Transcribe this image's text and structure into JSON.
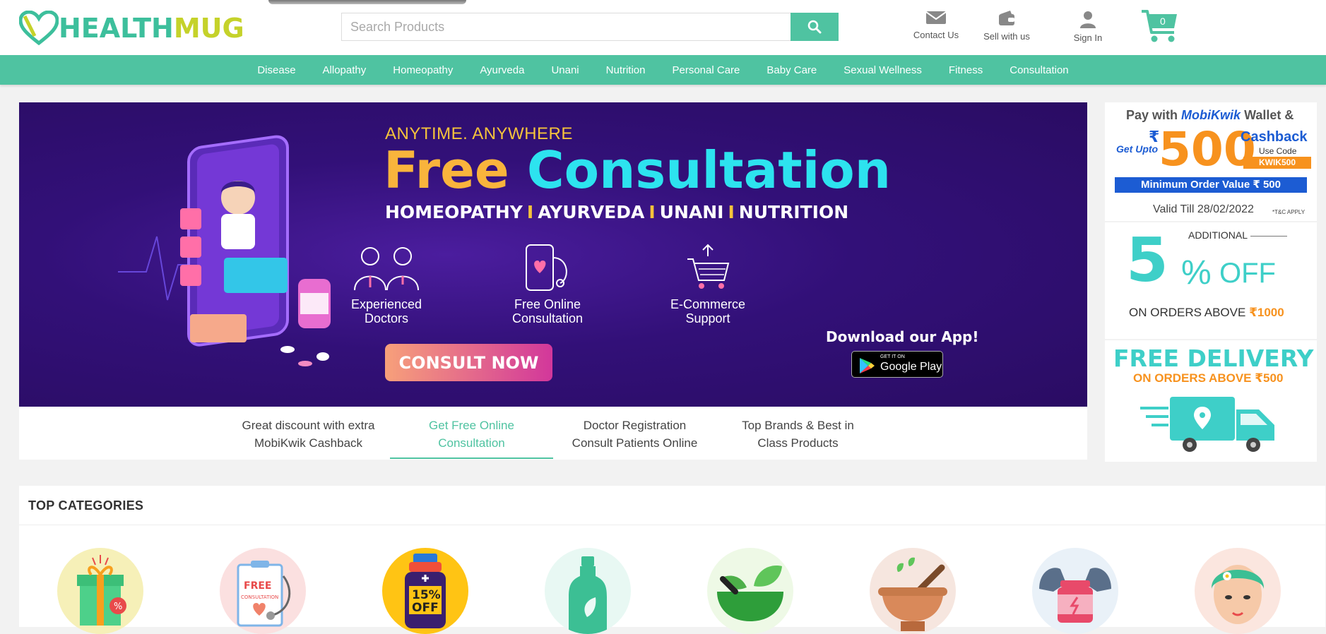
{
  "logo": {
    "part1": "HEALTH",
    "part2": "MUG"
  },
  "search": {
    "placeholder": "Search Products"
  },
  "header_links": {
    "contact": "Contact Us",
    "sell": "Sell with us",
    "signin": "Sign In"
  },
  "cart": {
    "count": "0"
  },
  "nav": [
    "Disease",
    "Allopathy",
    "Homeopathy",
    "Ayurveda",
    "Unani",
    "Nutrition",
    "Personal Care",
    "Baby Care",
    "Sexual Wellness",
    "Fitness",
    "Consultation"
  ],
  "banner": {
    "anytime": "ANYTIME. ANYWHERE",
    "title_free": "Free",
    "title_consult": "Consultation",
    "sub": [
      "HOMEOPATHY",
      "AYURVEDA",
      "UNANI",
      "NUTRITION"
    ],
    "sub_sep": "I",
    "features": [
      {
        "l1": "Experienced",
        "l2": "Doctors"
      },
      {
        "l1": "Free Online",
        "l2": "Consultation"
      },
      {
        "l1": "E-Commerce",
        "l2": "Support"
      }
    ],
    "cta": "CONSULT NOW",
    "download": "Download our App!",
    "gplay_small": "GET IT ON",
    "gplay_big": "Google Play"
  },
  "tabs": [
    {
      "l1": "Great discount with extra",
      "l2": "MobiKwik Cashback"
    },
    {
      "l1": "Get Free Online",
      "l2": "Consultation"
    },
    {
      "l1": "Doctor Registration",
      "l2": "Consult Patients Online"
    },
    {
      "l1": "Top Brands & Best in",
      "l2": "Class Products"
    }
  ],
  "promo1": {
    "pay": "Pay with",
    "brand": "MobiKwik",
    "wallet": "Wallet &",
    "rupee": "₹",
    "amount": "500",
    "getupto": "Get Upto",
    "cashback": "Cashback",
    "usecode": "Use Code",
    "code": "KWIK500",
    "min_order": "Minimum Order Value ₹ 500",
    "valid": "Valid Till 28/02/2022",
    "tc": "*T&C APPLY"
  },
  "promo2": {
    "additional": "ADDITIONAL",
    "num": "5",
    "pct": "%",
    "off": "OFF",
    "orders": "ON ORDERS ABOVE",
    "amount": "₹1000"
  },
  "promo3": {
    "line1": "FREE DELIVERY",
    "line2": "ON ORDERS ABOVE ₹500"
  },
  "categories": {
    "title": "TOP CATEGORIES",
    "badge_free": "FREE",
    "badge_consult": "CONSULTATION",
    "badge_pct": "15%",
    "badge_off": "OFF"
  },
  "colors": {
    "brand": "#4fc3a1",
    "banner": "#321078",
    "accent": "#f9b43c",
    "cyan": "#2de3ef"
  }
}
